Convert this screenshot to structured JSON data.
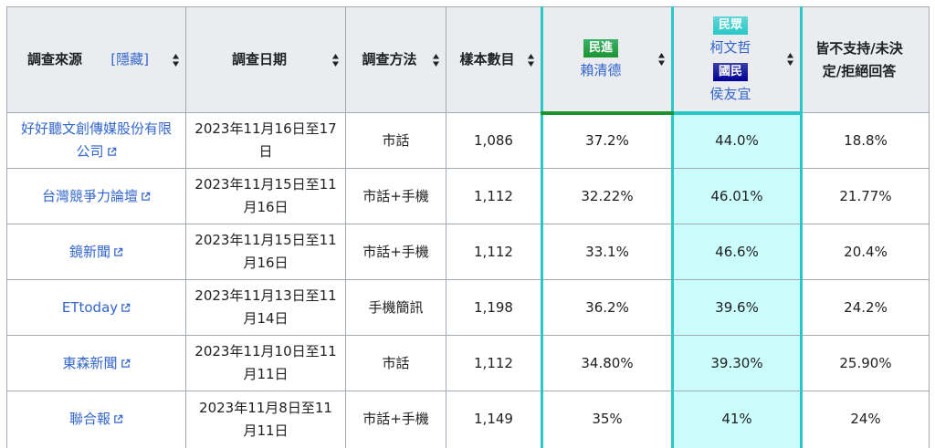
{
  "header": {
    "source": "調查來源",
    "hide": "[隱藏]",
    "date": "調查日期",
    "method": "調查方法",
    "sample": "樣本數目",
    "dpp_party": "民進",
    "dpp_candidate": "賴清德",
    "tpp_party": "民眾",
    "tpp_candidate": "柯文哲",
    "kmt_party": "國民",
    "kmt_candidate": "侯友宜",
    "undecided_line1": "皆不支持/未決",
    "undecided_line2": "定/拒絕回答"
  },
  "rows": [
    {
      "source": "好好聽文創傳媒股份有限公司",
      "date": "2023年11月16日至17日",
      "method": "市話",
      "sample": "1,086",
      "dpp": "37.2%",
      "tpp_kmt": "44.0%",
      "undecided": "18.8%"
    },
    {
      "source": "台灣競爭力論壇",
      "date": "2023年11月15日至11月16日",
      "method": "市話+手機",
      "sample": "1,112",
      "dpp": "32.22%",
      "tpp_kmt": "46.01%",
      "undecided": "21.77%"
    },
    {
      "source": "鏡新聞",
      "date": "2023年11月15日至11月16日",
      "method": "市話+手機",
      "sample": "1,112",
      "dpp": "33.1%",
      "tpp_kmt": "46.6%",
      "undecided": "20.4%"
    },
    {
      "source": "ETtoday",
      "date": "2023年11月13日至11月14日",
      "method": "手機簡訊",
      "sample": "1,198",
      "dpp": "36.2%",
      "tpp_kmt": "39.6%",
      "undecided": "24.2%"
    },
    {
      "source": "東森新聞",
      "date": "2023年11月10日至11月11日",
      "method": "市話",
      "sample": "1,112",
      "dpp": "34.80%",
      "tpp_kmt": "39.30%",
      "undecided": "25.90%"
    },
    {
      "source": "聯合報",
      "date": "2023年11月8日至11月11日",
      "method": "市話+手機",
      "sample": "1,149",
      "dpp": "35%",
      "tpp_kmt": "41%",
      "undecided": "24%"
    }
  ],
  "colors": {
    "link": "#3366cc",
    "dpp": "#1b9431",
    "tpp": "#28c8c8",
    "kmt": "#000095",
    "tpp_cell": "#ccfdfd",
    "header_bg": "#eaecf0"
  }
}
